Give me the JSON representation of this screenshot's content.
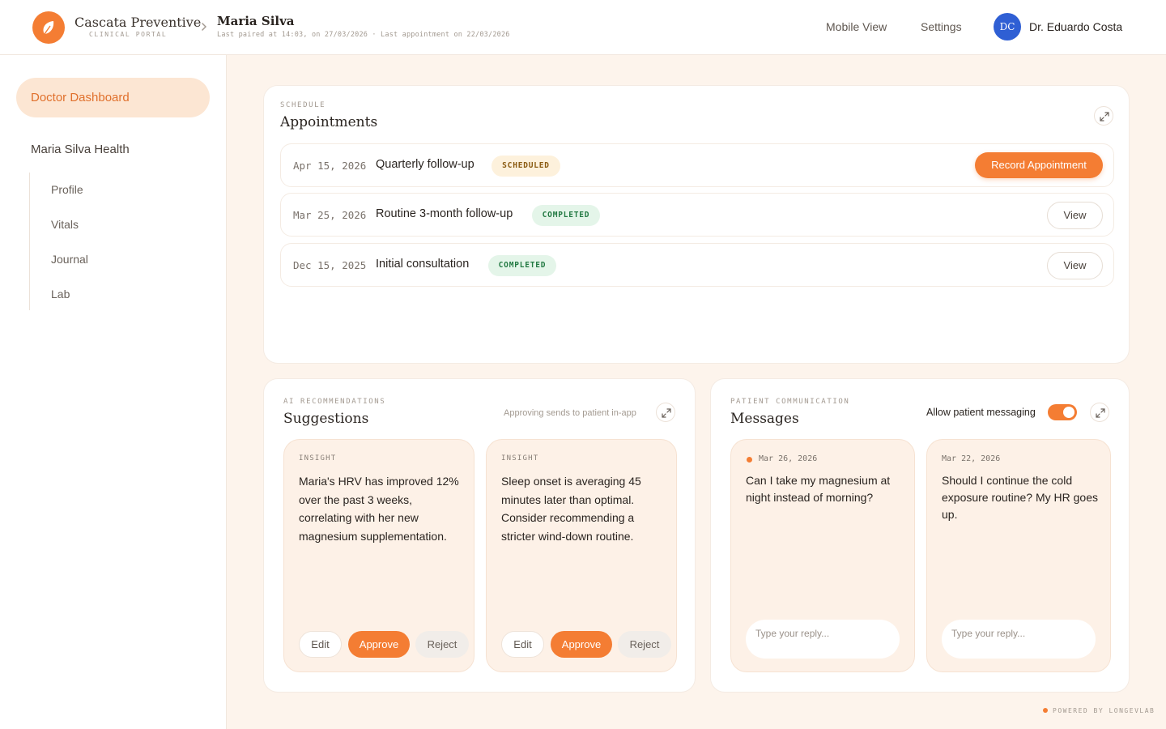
{
  "brand": {
    "name": "Cascata Preventive",
    "subtitle": "CLINICAL PORTAL"
  },
  "header": {
    "patient_name": "Maria Silva",
    "patient_meta": "Last paired at 14:03, on 27/03/2026 · Last appointment on 22/03/2026",
    "nav": {
      "mobile_view": "Mobile View",
      "settings": "Settings"
    },
    "user": {
      "initials": "DC",
      "name": "Dr. Eduardo Costa"
    }
  },
  "sidebar": {
    "active": "Doctor Dashboard",
    "section": "Maria Silva Health",
    "items": [
      {
        "label": "Profile"
      },
      {
        "label": "Vitals"
      },
      {
        "label": "Journal"
      },
      {
        "label": "Lab"
      }
    ]
  },
  "appointments": {
    "eyebrow": "SCHEDULE",
    "title": "Appointments",
    "rows": [
      {
        "date": "Apr 15, 2026",
        "title": "Quarterly follow-up",
        "status": "SCHEDULED",
        "action": "Record Appointment"
      },
      {
        "date": "Mar 25, 2026",
        "title": "Routine 3-month follow-up",
        "status": "COMPLETED",
        "action": "View"
      },
      {
        "date": "Dec 15, 2025",
        "title": "Initial consultation",
        "status": "COMPLETED",
        "action": "View"
      }
    ]
  },
  "suggestions": {
    "eyebrow": "AI RECOMMENDATIONS",
    "title": "Suggestions",
    "hint": "Approving sends to patient in-app",
    "cards": [
      {
        "tag": "INSIGHT",
        "text": "Maria's HRV has improved 12% over the past 3 weeks, correlating with her new magnesium supplementation.",
        "edit": "Edit",
        "approve": "Approve",
        "reject": "Reject"
      },
      {
        "tag": "INSIGHT",
        "text": "Sleep onset is averaging 45 minutes later than optimal. Consider recommending a stricter wind-down routine.",
        "edit": "Edit",
        "approve": "Approve",
        "reject": "Reject"
      }
    ]
  },
  "messages": {
    "eyebrow": "PATIENT COMMUNICATION",
    "title": "Messages",
    "toggle_label": "Allow patient messaging",
    "toggle_on": true,
    "items": [
      {
        "date": "Mar 26, 2026",
        "unread": true,
        "text": "Can I take my magnesium at night instead of morning?",
        "reply_placeholder": "Type your reply..."
      },
      {
        "date": "Mar 22, 2026",
        "unread": false,
        "text": "Should I continue the cold exposure routine? My HR goes up.",
        "reply_placeholder": "Type your reply..."
      }
    ]
  },
  "footer": {
    "text": "POWERED BY LONGEVLAB"
  },
  "colors": {
    "accent": "#f47d33",
    "background": "#fdf4ec",
    "avatar": "#2f5fd4"
  }
}
